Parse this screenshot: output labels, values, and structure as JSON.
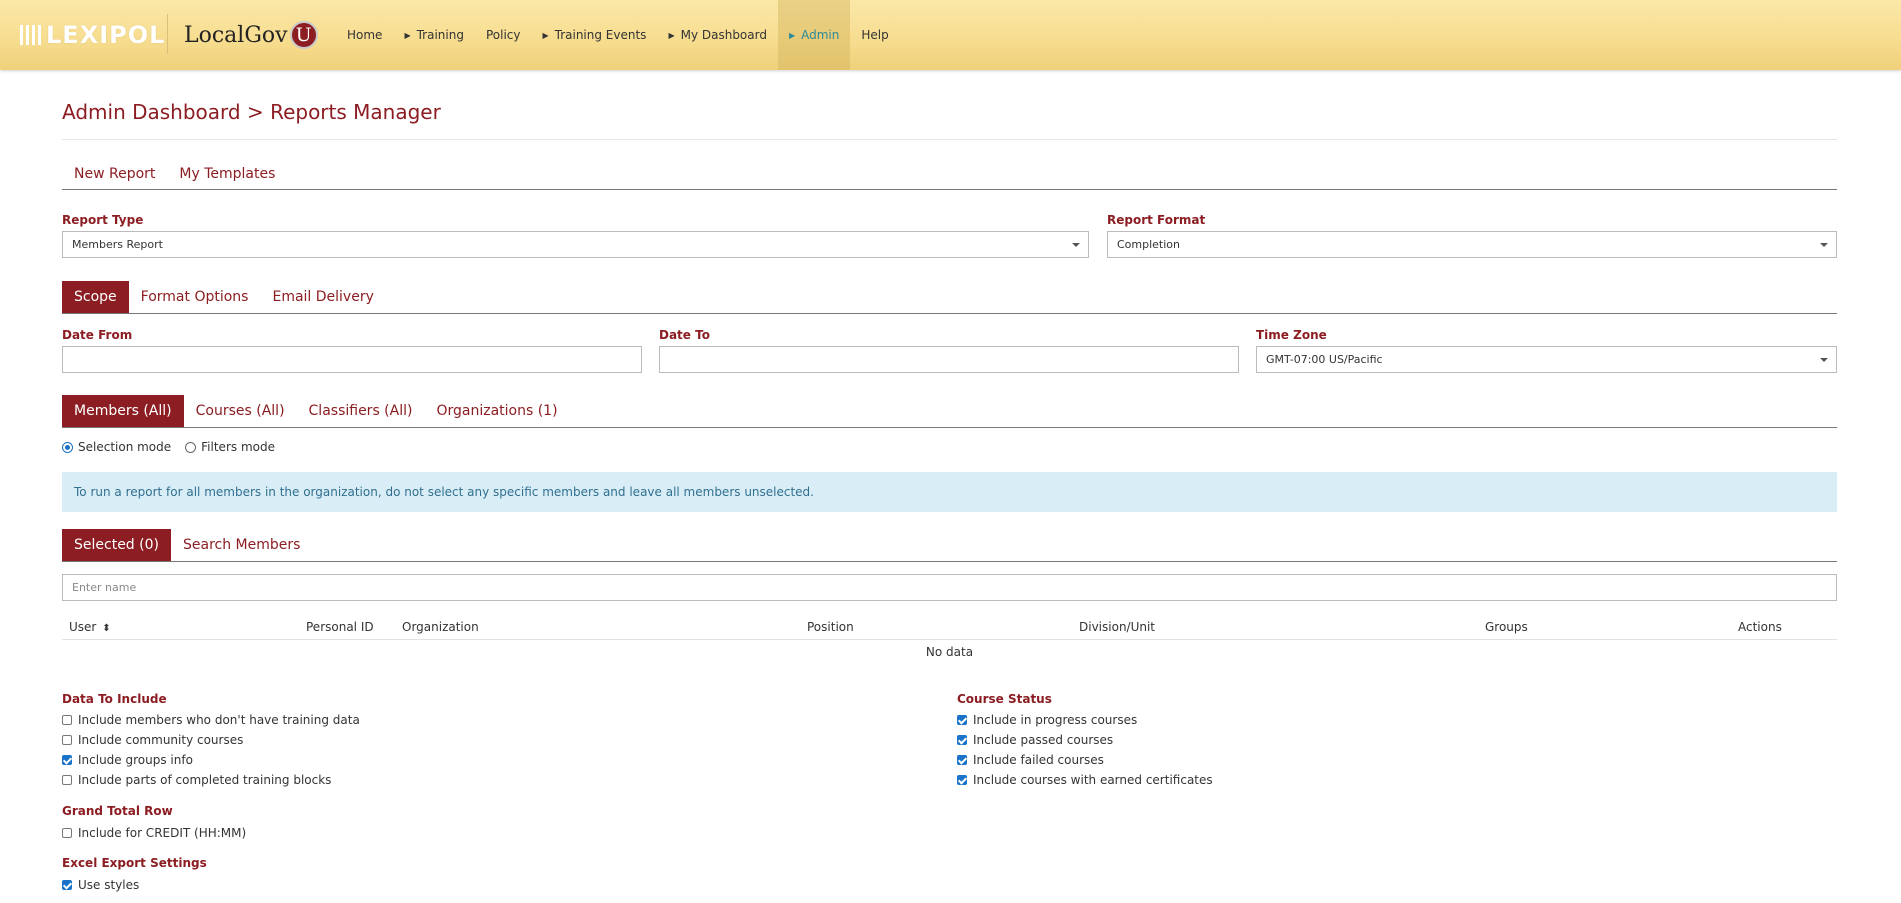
{
  "brand": {
    "lexipol": "LEXIPOL",
    "localgov": "LocalGov",
    "u": "U"
  },
  "nav": [
    {
      "label": "Home",
      "caret": false,
      "active": false
    },
    {
      "label": "Training",
      "caret": true,
      "active": false
    },
    {
      "label": "Policy",
      "caret": false,
      "active": false
    },
    {
      "label": "Training Events",
      "caret": true,
      "active": false
    },
    {
      "label": "My Dashboard",
      "caret": true,
      "active": false
    },
    {
      "label": "Admin",
      "caret": true,
      "active": true
    },
    {
      "label": "Help",
      "caret": false,
      "active": false
    }
  ],
  "page_title": "Admin Dashboard > Reports Manager",
  "report_tabs": [
    "New Report",
    "My Templates"
  ],
  "report_type": {
    "label": "Report Type",
    "value": "Members Report"
  },
  "report_format": {
    "label": "Report Format",
    "value": "Completion"
  },
  "settings_tabs": [
    "Scope",
    "Format Options",
    "Email Delivery"
  ],
  "date_from": {
    "label": "Date From",
    "value": ""
  },
  "date_to": {
    "label": "Date To",
    "value": ""
  },
  "time_zone": {
    "label": "Time Zone",
    "value": "GMT-07:00 US/Pacific"
  },
  "scope_tabs": [
    "Members (All)",
    "Courses (All)",
    "Classifiers (All)",
    "Organizations (1)"
  ],
  "mode": {
    "selection": "Selection mode",
    "filters": "Filters mode"
  },
  "info_text": "To run a report for all members in the organization, do not select any specific members and leave all members unselected.",
  "member_tabs": [
    "Selected (0)",
    "Search Members"
  ],
  "name_filter": {
    "placeholder": "Enter name"
  },
  "table": {
    "columns": [
      "User",
      "Personal ID",
      "Organization",
      "Position",
      "Division/Unit",
      "Groups",
      "Actions"
    ],
    "sort_icon": "⬍",
    "empty": "No data"
  },
  "data_to_include": {
    "title": "Data To Include",
    "items": [
      {
        "label": "Include members who don't have training data",
        "checked": false
      },
      {
        "label": "Include community courses",
        "checked": false
      },
      {
        "label": "Include groups info",
        "checked": true
      },
      {
        "label": "Include parts of completed training blocks",
        "checked": false
      }
    ]
  },
  "course_status": {
    "title": "Course Status",
    "items": [
      {
        "label": "Include in progress courses",
        "checked": true
      },
      {
        "label": "Include passed courses",
        "checked": true
      },
      {
        "label": "Include failed courses",
        "checked": true
      },
      {
        "label": "Include courses with earned certificates",
        "checked": true
      }
    ]
  },
  "grand_total": {
    "title": "Grand Total Row",
    "items": [
      {
        "label": "Include for CREDIT (HH:MM)",
        "checked": false
      }
    ]
  },
  "excel_export": {
    "title": "Excel Export Settings",
    "items": [
      {
        "label": "Use styles",
        "checked": true
      }
    ]
  },
  "colors": {
    "accent": "#8c1d22",
    "nav_active": "#2a8a9a",
    "info_bg": "#d9edf7",
    "info_text": "#31708f",
    "check": "#1a73c8"
  }
}
